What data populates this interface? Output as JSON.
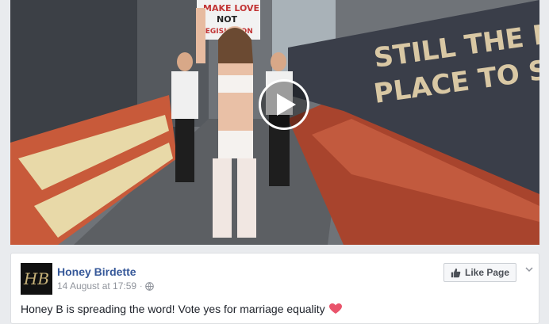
{
  "video": {
    "sign_text_1": "MAKE LOVE",
    "sign_text_2": "NOT",
    "sign_text_3": "LEGISLATION",
    "banner_text_1": "STILL THE BEST",
    "banner_text_2": "PLACE TO SHOP",
    "play_icon": "play-icon"
  },
  "post": {
    "page_name": "Honey Birdette",
    "avatar_letter": "HB",
    "date": "14 August at 17:59",
    "privacy_icon": "globe-icon",
    "like_button_label": "Like Page",
    "text": "Honey B is spreading the word! Vote yes for marriage equality",
    "emoji_icon": "heart-icon"
  },
  "colors": {
    "link": "#365899",
    "meta": "#90949c",
    "heart": "#e9546b"
  }
}
